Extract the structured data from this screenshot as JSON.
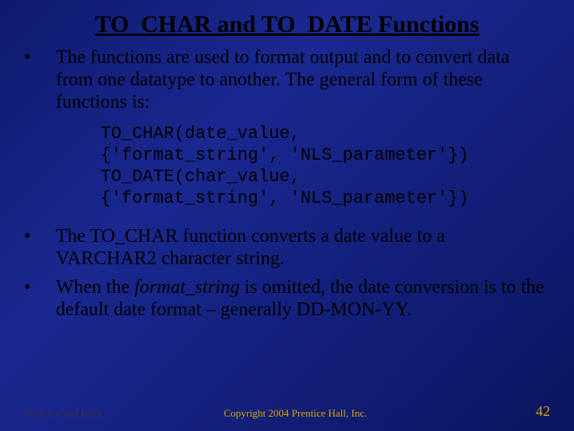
{
  "title": "TO_CHAR and TO_DATE Functions",
  "bullets": [
    "The functions are used to format output and to convert data from one datatype to another.  The general form of these functions is:",
    "The TO_CHAR function converts a date value to a VARCHAR2 character string.",
    "When the format_string is omitted, the date conversion is to the default date format – generally DD-MON-YY."
  ],
  "code": {
    "l1": "TO_CHAR(date_value,",
    "l2": "{'format_string', 'NLS_parameter'})",
    "l3": "TO_DATE(char_value,",
    "l4": "{'format_string', 'NLS_parameter'})"
  },
  "bullet3_parts": {
    "pre": "When the ",
    "italic": "format_string",
    "post": " is omitted, the date conversion is to the default date format – generally DD-MON-YY."
  },
  "footer": {
    "left": "Bordoloi and Bock",
    "center": "Copyright 2004 Prentice Hall, Inc.",
    "right": "42"
  }
}
